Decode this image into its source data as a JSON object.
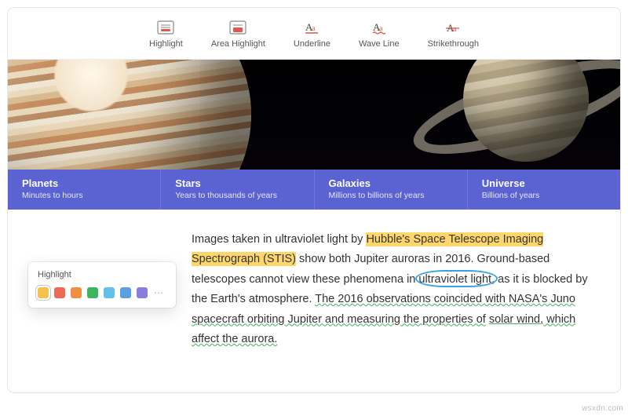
{
  "toolbar": {
    "highlight": "Highlight",
    "area_highlight": "Area Highlight",
    "underline": "Underline",
    "wave_line": "Wave Line",
    "strikethrough": "Strikethrough"
  },
  "band": [
    {
      "title": "Planets",
      "subtitle": "Minutes to hours"
    },
    {
      "title": "Stars",
      "subtitle": "Years to thousands of years"
    },
    {
      "title": "Galaxies",
      "subtitle": "Millions to billions of years"
    },
    {
      "title": "Universe",
      "subtitle": "Billions of years"
    }
  ],
  "article": {
    "pre1": "Images taken in ultraviolet light by ",
    "highlighted": "Hubble's Space Telescope Imaging Spectrograph (STIS)",
    "post1": " show both Jupiter auroras in 2016. Ground-based telescopes cannot view these phenomena in ",
    "circled": "ultraviolet light,",
    "post2": " as it is blocked by  the Earth's atmosphere. ",
    "wavy1": "The 2016 observations coincided with NASA's Juno  spacecraft orbiting Jupiter and measuring the properties of",
    "space": " ",
    "underlined": "solar wind,",
    "wavy2": " which affect the aurora."
  },
  "palette": {
    "title": "Highlight",
    "colors": [
      "#f4c14f",
      "#ec6a56",
      "#ef8f44",
      "#3cb55f",
      "#63c0e8",
      "#5aa1e3",
      "#8a7de0"
    ],
    "selected_index": 0
  },
  "accent_colors": {
    "highlight": "#ffd66b",
    "circle": "#3aa0e0",
    "wavy": "#3cb55f",
    "band_bg": "#5a63d1"
  },
  "watermark": "wsxdn.com"
}
